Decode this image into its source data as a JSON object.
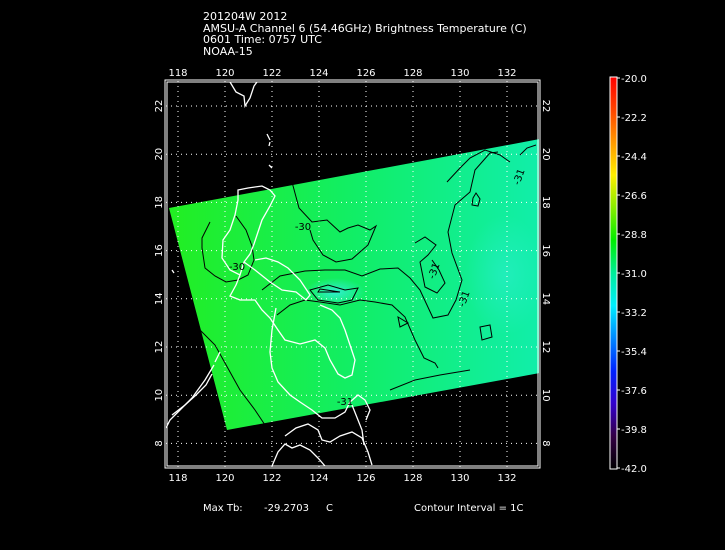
{
  "header": {
    "lines": [
      "201204W 2012",
      "AMSU-A Channel 6 (54.46GHz) Brightness Temperature (C)",
      "0601 Time: 0757 UTC",
      "NOAA-15"
    ]
  },
  "map": {
    "lon_ticks": [
      "118",
      "120",
      "122",
      "124",
      "126",
      "128",
      "130",
      "132"
    ],
    "lat_ticks": [
      "22",
      "20",
      "18",
      "16",
      "14",
      "12",
      "10",
      "8"
    ],
    "contour_labels": [
      "-30",
      "-30",
      "-31",
      "-31",
      "-31",
      "-31"
    ],
    "swath_colors": {
      "west": "#22ee22",
      "center": "#11ee66",
      "east": "#11eeaa",
      "minimum": "#33eedd"
    },
    "coast_color": "#ffffff",
    "contour_color": "#000000"
  },
  "colorbar": {
    "labels": [
      "-20.0",
      "-22.2",
      "-24.4",
      "-26.6",
      "-28.8",
      "-31.0",
      "-33.2",
      "-35.4",
      "-37.6",
      "-39.8",
      "-42.0"
    ],
    "stops": [
      "#ff0000",
      "#ff4400",
      "#ff9900",
      "#ffee00",
      "#88ee00",
      "#00ee00",
      "#00ee99",
      "#00eeff",
      "#0088ff",
      "#0022ff",
      "#3300cc",
      "#330044",
      "#000000"
    ]
  },
  "footer": {
    "max_tb_label": "Max Tb:",
    "max_tb_value": "-29.2703",
    "max_tb_unit": "C",
    "contour_interval": "Contour Interval = 1C"
  }
}
